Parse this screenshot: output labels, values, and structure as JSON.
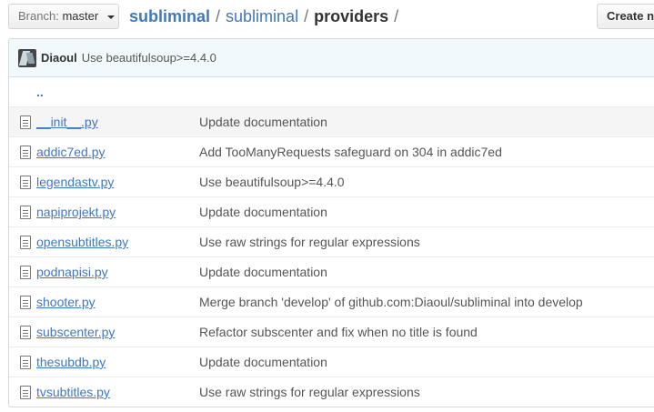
{
  "branch": {
    "prefix": "Branch:",
    "name": "master"
  },
  "breadcrumb": {
    "root": "subliminal",
    "sep1": "/",
    "middle": "subliminal",
    "sep2": "/",
    "current": "providers",
    "sep3": "/"
  },
  "create_button": "Create new file",
  "commit": {
    "author": "Diaoul",
    "message": "Use beautifulsoup>=4.4.0"
  },
  "updir": "..",
  "files": [
    {
      "name": "__init__.py",
      "message": "Update documentation"
    },
    {
      "name": "addic7ed.py",
      "message": "Add TooManyRequests safeguard on 304 in addic7ed"
    },
    {
      "name": "legendastv.py",
      "message": "Use beautifulsoup>=4.4.0"
    },
    {
      "name": "napiprojekt.py",
      "message": "Update documentation"
    },
    {
      "name": "opensubtitles.py",
      "message": "Use raw strings for regular expressions"
    },
    {
      "name": "podnapisi.py",
      "message": "Update documentation"
    },
    {
      "name": "shooter.py",
      "message": "Merge branch 'develop' of github.com:Diaoul/subliminal into develop"
    },
    {
      "name": "subscenter.py",
      "message": "Refactor subscenter and fix when no title is found"
    },
    {
      "name": "thesubdb.py",
      "message": "Update documentation"
    },
    {
      "name": "tvsubtitles.py",
      "message": "Use raw strings for regular expressions"
    }
  ]
}
